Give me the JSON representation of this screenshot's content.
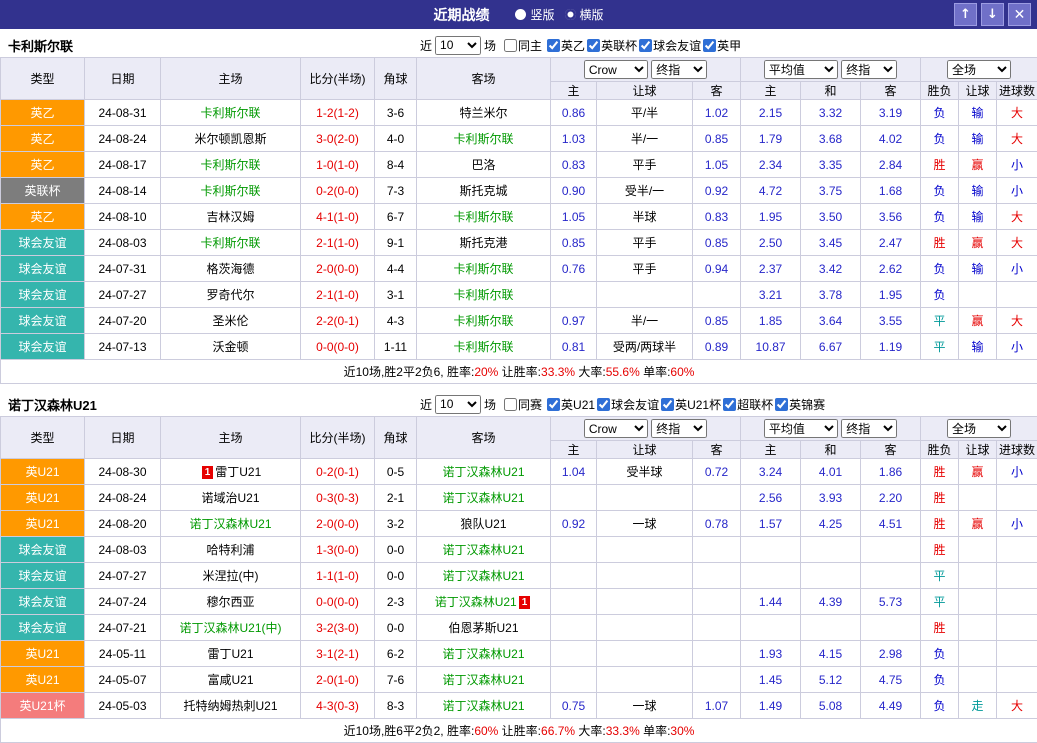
{
  "colors": {
    "titlebar_bg": "#32328e",
    "win_red": "#e60000",
    "lose_blue": "#0000cc",
    "draw_teal": "#009999",
    "team_highlight_green": "#009900",
    "odds_blue": "#2626c9",
    "type_orange": "#ff9900",
    "type_gray": "#7d7d7d",
    "type_teal": "#35b5ad",
    "type_salmon": "#f47c7c"
  },
  "titlebar": {
    "title": "近期战绩",
    "layout_options": [
      {
        "label": "竖版",
        "selected": false
      },
      {
        "label": "横版",
        "selected": true
      }
    ],
    "up_icon": "↑",
    "down_icon": "↓",
    "close_icon": "✕"
  },
  "controls": {
    "near_label": "近",
    "count_value": "10",
    "games_label": "场",
    "price_select": "Crow",
    "final_select": "终指",
    "average_select": "平均值",
    "scope_select": "全场"
  },
  "table_headers": {
    "type": "类型",
    "date": "日期",
    "home": "主场",
    "score": "比分(半场)",
    "corner": "角球",
    "away": "客场",
    "odds_home": "主",
    "odds_handicap": "让球",
    "odds_away": "客",
    "avg_home": "主",
    "avg_draw": "和",
    "avg_away": "客",
    "result": "胜负",
    "handicap_result": "让球",
    "goals": "进球数"
  },
  "sections": [
    {
      "team": "卡利斯尔联",
      "same_filter": {
        "label": "同主",
        "checked": false
      },
      "league_filters": [
        {
          "label": "英乙",
          "checked": true
        },
        {
          "label": "英联杯",
          "checked": true
        },
        {
          "label": "球会友谊",
          "checked": true
        },
        {
          "label": "英甲",
          "checked": true
        }
      ],
      "rows": [
        {
          "type": "英乙",
          "type_color": "orange",
          "date": "24-08-31",
          "home": "卡利斯尔联",
          "home_team": true,
          "home_badge": "",
          "score": "1-2(1-2)",
          "corner": "3-6",
          "away": "特兰米尔",
          "away_team": false,
          "away_badge": "",
          "odds": [
            "0.86",
            "平/半",
            "1.02"
          ],
          "avg": [
            "2.15",
            "3.32",
            "3.19"
          ],
          "result": {
            "text": "负",
            "color": "blue"
          },
          "let": {
            "text": "输",
            "color": "blue"
          },
          "goal": {
            "text": "大",
            "color": "red"
          }
        },
        {
          "type": "英乙",
          "type_color": "orange",
          "date": "24-08-24",
          "home": "米尔顿凯恩斯",
          "home_team": false,
          "home_badge": "",
          "score": "3-0(2-0)",
          "corner": "4-0",
          "away": "卡利斯尔联",
          "away_team": true,
          "away_badge": "",
          "odds": [
            "1.03",
            "半/一",
            "0.85"
          ],
          "avg": [
            "1.79",
            "3.68",
            "4.02"
          ],
          "result": {
            "text": "负",
            "color": "blue"
          },
          "let": {
            "text": "输",
            "color": "blue"
          },
          "goal": {
            "text": "大",
            "color": "red"
          }
        },
        {
          "type": "英乙",
          "type_color": "orange",
          "date": "24-08-17",
          "home": "卡利斯尔联",
          "home_team": true,
          "home_badge": "",
          "score": "1-0(1-0)",
          "corner": "8-4",
          "away": "巴洛",
          "away_team": false,
          "away_badge": "",
          "odds": [
            "0.83",
            "平手",
            "1.05"
          ],
          "avg": [
            "2.34",
            "3.35",
            "2.84"
          ],
          "result": {
            "text": "胜",
            "color": "red"
          },
          "let": {
            "text": "赢",
            "color": "red"
          },
          "goal": {
            "text": "小",
            "color": "blue"
          }
        },
        {
          "type": "英联杯",
          "type_color": "gray",
          "date": "24-08-14",
          "home": "卡利斯尔联",
          "home_team": true,
          "home_badge": "",
          "score": "0-2(0-0)",
          "corner": "7-3",
          "away": "斯托克城",
          "away_team": false,
          "away_badge": "",
          "odds": [
            "0.90",
            "受半/一",
            "0.92"
          ],
          "avg": [
            "4.72",
            "3.75",
            "1.68"
          ],
          "result": {
            "text": "负",
            "color": "blue"
          },
          "let": {
            "text": "输",
            "color": "blue"
          },
          "goal": {
            "text": "小",
            "color": "blue"
          }
        },
        {
          "type": "英乙",
          "type_color": "orange",
          "date": "24-08-10",
          "home": "吉林汉姆",
          "home_team": false,
          "home_badge": "",
          "score": "4-1(1-0)",
          "corner": "6-7",
          "away": "卡利斯尔联",
          "away_team": true,
          "away_badge": "",
          "odds": [
            "1.05",
            "半球",
            "0.83"
          ],
          "avg": [
            "1.95",
            "3.50",
            "3.56"
          ],
          "result": {
            "text": "负",
            "color": "blue"
          },
          "let": {
            "text": "输",
            "color": "blue"
          },
          "goal": {
            "text": "大",
            "color": "red"
          }
        },
        {
          "type": "球会友谊",
          "type_color": "teal",
          "date": "24-08-03",
          "home": "卡利斯尔联",
          "home_team": true,
          "home_badge": "",
          "score": "2-1(1-0)",
          "corner": "9-1",
          "away": "斯托克港",
          "away_team": false,
          "away_badge": "",
          "odds": [
            "0.85",
            "平手",
            "0.85"
          ],
          "avg": [
            "2.50",
            "3.45",
            "2.47"
          ],
          "result": {
            "text": "胜",
            "color": "red"
          },
          "let": {
            "text": "赢",
            "color": "red"
          },
          "goal": {
            "text": "大",
            "color": "red"
          }
        },
        {
          "type": "球会友谊",
          "type_color": "teal",
          "date": "24-07-31",
          "home": "格茨海德",
          "home_team": false,
          "home_badge": "",
          "score": "2-0(0-0)",
          "corner": "4-4",
          "away": "卡利斯尔联",
          "away_team": true,
          "away_badge": "",
          "odds": [
            "0.76",
            "平手",
            "0.94"
          ],
          "avg": [
            "2.37",
            "3.42",
            "2.62"
          ],
          "result": {
            "text": "负",
            "color": "blue"
          },
          "let": {
            "text": "输",
            "color": "blue"
          },
          "goal": {
            "text": "小",
            "color": "blue"
          }
        },
        {
          "type": "球会友谊",
          "type_color": "teal",
          "date": "24-07-27",
          "home": "罗奇代尔",
          "home_team": false,
          "home_badge": "",
          "score": "2-1(1-0)",
          "corner": "3-1",
          "away": "卡利斯尔联",
          "away_team": true,
          "away_badge": "",
          "odds": [
            "",
            "",
            ""
          ],
          "avg": [
            "3.21",
            "3.78",
            "1.95"
          ],
          "result": {
            "text": "负",
            "color": "blue"
          },
          "let": {
            "text": "",
            "color": ""
          },
          "goal": {
            "text": "",
            "color": ""
          }
        },
        {
          "type": "球会友谊",
          "type_color": "teal",
          "date": "24-07-20",
          "home": "圣米伦",
          "home_team": false,
          "home_badge": "",
          "score": "2-2(0-1)",
          "corner": "4-3",
          "away": "卡利斯尔联",
          "away_team": true,
          "away_badge": "",
          "odds": [
            "0.97",
            "半/一",
            "0.85"
          ],
          "avg": [
            "1.85",
            "3.64",
            "3.55"
          ],
          "result": {
            "text": "平",
            "color": "teal"
          },
          "let": {
            "text": "赢",
            "color": "red"
          },
          "goal": {
            "text": "大",
            "color": "red"
          }
        },
        {
          "type": "球会友谊",
          "type_color": "teal",
          "date": "24-07-13",
          "home": "沃金顿",
          "home_team": false,
          "home_badge": "",
          "score": "0-0(0-0)",
          "corner": "1-11",
          "away": "卡利斯尔联",
          "away_team": true,
          "away_badge": "",
          "odds": [
            "0.81",
            "受两/两球半",
            "0.89"
          ],
          "avg": [
            "10.87",
            "6.67",
            "1.19"
          ],
          "result": {
            "text": "平",
            "color": "teal"
          },
          "let": {
            "text": "输",
            "color": "blue"
          },
          "goal": {
            "text": "小",
            "color": "blue"
          }
        }
      ],
      "summary": [
        {
          "text": "近10场,胜2平2负6, 胜率:",
          "color": "black"
        },
        {
          "text": "20%",
          "color": "red"
        },
        {
          "text": " 让胜率:",
          "color": "black"
        },
        {
          "text": "33.3%",
          "color": "red"
        },
        {
          "text": " 大率:",
          "color": "black"
        },
        {
          "text": "55.6%",
          "color": "red"
        },
        {
          "text": " 单率:",
          "color": "black"
        },
        {
          "text": "60%",
          "color": "red"
        }
      ]
    },
    {
      "team": "诺丁汉森林U21",
      "same_filter": {
        "label": "同赛",
        "checked": false
      },
      "league_filters": [
        {
          "label": "英U21",
          "checked": true
        },
        {
          "label": "球会友谊",
          "checked": true
        },
        {
          "label": "英U21杯",
          "checked": true
        },
        {
          "label": "超联杯",
          "checked": true
        },
        {
          "label": "英锦赛",
          "checked": true
        }
      ],
      "rows": [
        {
          "type": "英U21",
          "type_color": "orange",
          "date": "24-08-30",
          "home": "雷丁U21",
          "home_team": false,
          "home_badge": "1",
          "score": "0-2(0-1)",
          "corner": "0-5",
          "away": "诺丁汉森林U21",
          "away_team": true,
          "away_badge": "",
          "odds": [
            "1.04",
            "受半球",
            "0.72"
          ],
          "avg": [
            "3.24",
            "4.01",
            "1.86"
          ],
          "result": {
            "text": "胜",
            "color": "red"
          },
          "let": {
            "text": "赢",
            "color": "red"
          },
          "goal": {
            "text": "小",
            "color": "blue"
          }
        },
        {
          "type": "英U21",
          "type_color": "orange",
          "date": "24-08-24",
          "home": "诺域治U21",
          "home_team": false,
          "home_badge": "",
          "score": "0-3(0-3)",
          "corner": "2-1",
          "away": "诺丁汉森林U21",
          "away_team": true,
          "away_badge": "",
          "odds": [
            "",
            "",
            ""
          ],
          "avg": [
            "2.56",
            "3.93",
            "2.20"
          ],
          "result": {
            "text": "胜",
            "color": "red"
          },
          "let": {
            "text": "",
            "color": ""
          },
          "goal": {
            "text": "",
            "color": ""
          }
        },
        {
          "type": "英U21",
          "type_color": "orange",
          "date": "24-08-20",
          "home": "诺丁汉森林U21",
          "home_team": true,
          "home_badge": "",
          "score": "2-0(0-0)",
          "corner": "3-2",
          "away": "狼队U21",
          "away_team": false,
          "away_badge": "",
          "odds": [
            "0.92",
            "一球",
            "0.78"
          ],
          "avg": [
            "1.57",
            "4.25",
            "4.51"
          ],
          "result": {
            "text": "胜",
            "color": "red"
          },
          "let": {
            "text": "赢",
            "color": "red"
          },
          "goal": {
            "text": "小",
            "color": "blue"
          }
        },
        {
          "type": "球会友谊",
          "type_color": "teal",
          "date": "24-08-03",
          "home": "哈特利浦",
          "home_team": false,
          "home_badge": "",
          "score": "1-3(0-0)",
          "corner": "0-0",
          "away": "诺丁汉森林U21",
          "away_team": true,
          "away_badge": "",
          "odds": [
            "",
            "",
            ""
          ],
          "avg": [
            "",
            "",
            ""
          ],
          "result": {
            "text": "胜",
            "color": "red"
          },
          "let": {
            "text": "",
            "color": ""
          },
          "goal": {
            "text": "",
            "color": ""
          }
        },
        {
          "type": "球会友谊",
          "type_color": "teal",
          "date": "24-07-27",
          "home": "米涅拉(中)",
          "home_team": false,
          "home_badge": "",
          "score": "1-1(1-0)",
          "corner": "0-0",
          "away": "诺丁汉森林U21",
          "away_team": true,
          "away_badge": "",
          "odds": [
            "",
            "",
            ""
          ],
          "avg": [
            "",
            "",
            ""
          ],
          "result": {
            "text": "平",
            "color": "teal"
          },
          "let": {
            "text": "",
            "color": ""
          },
          "goal": {
            "text": "",
            "color": ""
          }
        },
        {
          "type": "球会友谊",
          "type_color": "teal",
          "date": "24-07-24",
          "home": "穆尔西亚",
          "home_team": false,
          "home_badge": "",
          "score": "0-0(0-0)",
          "corner": "2-3",
          "away": "诺丁汉森林U21",
          "away_team": true,
          "away_badge": "1",
          "odds": [
            "",
            "",
            ""
          ],
          "avg": [
            "1.44",
            "4.39",
            "5.73"
          ],
          "result": {
            "text": "平",
            "color": "teal"
          },
          "let": {
            "text": "",
            "color": ""
          },
          "goal": {
            "text": "",
            "color": ""
          }
        },
        {
          "type": "球会友谊",
          "type_color": "teal",
          "date": "24-07-21",
          "home": "诺丁汉森林U21(中)",
          "home_team": true,
          "home_badge": "",
          "score": "3-2(3-0)",
          "corner": "0-0",
          "away": "伯恩茅斯U21",
          "away_team": false,
          "away_badge": "",
          "odds": [
            "",
            "",
            ""
          ],
          "avg": [
            "",
            "",
            ""
          ],
          "result": {
            "text": "胜",
            "color": "red"
          },
          "let": {
            "text": "",
            "color": ""
          },
          "goal": {
            "text": "",
            "color": ""
          }
        },
        {
          "type": "英U21",
          "type_color": "orange",
          "date": "24-05-11",
          "home": "雷丁U21",
          "home_team": false,
          "home_badge": "",
          "score": "3-1(2-1)",
          "corner": "6-2",
          "away": "诺丁汉森林U21",
          "away_team": true,
          "away_badge": "",
          "odds": [
            "",
            "",
            ""
          ],
          "avg": [
            "1.93",
            "4.15",
            "2.98"
          ],
          "result": {
            "text": "负",
            "color": "blue"
          },
          "let": {
            "text": "",
            "color": ""
          },
          "goal": {
            "text": "",
            "color": ""
          }
        },
        {
          "type": "英U21",
          "type_color": "orange",
          "date": "24-05-07",
          "home": "富咸U21",
          "home_team": false,
          "home_badge": "",
          "score": "2-0(1-0)",
          "corner": "7-6",
          "away": "诺丁汉森林U21",
          "away_team": true,
          "away_badge": "",
          "odds": [
            "",
            "",
            ""
          ],
          "avg": [
            "1.45",
            "5.12",
            "4.75"
          ],
          "result": {
            "text": "负",
            "color": "blue"
          },
          "let": {
            "text": "",
            "color": ""
          },
          "goal": {
            "text": "",
            "color": ""
          }
        },
        {
          "type": "英U21杯",
          "type_color": "salmon",
          "date": "24-05-03",
          "home": "托特纳姆热刺U21",
          "home_team": false,
          "home_badge": "",
          "score": "4-3(0-3)",
          "corner": "8-3",
          "away": "诺丁汉森林U21",
          "away_team": true,
          "away_badge": "",
          "odds": [
            "0.75",
            "一球",
            "1.07"
          ],
          "avg": [
            "1.49",
            "5.08",
            "4.49"
          ],
          "result": {
            "text": "负",
            "color": "blue"
          },
          "let": {
            "text": "走",
            "color": "teal"
          },
          "goal": {
            "text": "大",
            "color": "red"
          }
        }
      ],
      "summary": [
        {
          "text": "近10场,胜6平2负2, 胜率:",
          "color": "black"
        },
        {
          "text": "60%",
          "color": "red"
        },
        {
          "text": " 让胜率:",
          "color": "black"
        },
        {
          "text": "66.7%",
          "color": "red"
        },
        {
          "text": " 大率:",
          "color": "black"
        },
        {
          "text": "33.3%",
          "color": "red"
        },
        {
          "text": " 单率:",
          "color": "black"
        },
        {
          "text": "30%",
          "color": "red"
        }
      ]
    }
  ]
}
